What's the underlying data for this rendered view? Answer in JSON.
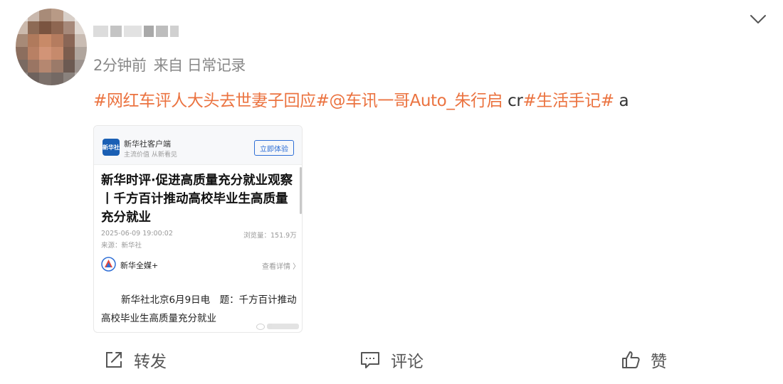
{
  "post": {
    "username": "",
    "time": "2分钟前",
    "source": "来自 日常记录",
    "content": {
      "tag1": "#网红车评人大头去世妻子回应#",
      "mention": "@车讯一哥Auto_朱行启",
      "plain1": " cr",
      "tag2": "#生活手记#",
      "plain2": " a"
    }
  },
  "card": {
    "app_logo_text": "新华社",
    "app_name": "新华社客户端",
    "app_slogan": "主流价值 从新看见",
    "try_button": "立即体验",
    "title": "新华时评·促进高质量充分就业观察丨千方百计推动高校毕业生高质量充分就业",
    "date": "2025-06-09 19:00:02",
    "views": "浏览量：151.9万",
    "source": "来源：新华社",
    "media_name": "新华全媒+",
    "detail_link": "查看详情 〉",
    "paragraph": "新华社北京6月9日电　题：千方百计推动高校毕业生高质量充分就业"
  },
  "actions": {
    "repost": "转发",
    "comment": "评论",
    "like": "赞"
  },
  "icons": [
    "chevron-down-icon",
    "repost-icon",
    "comment-icon",
    "like-icon",
    "media-logo-icon"
  ],
  "colors": {
    "topic": "#eb7340",
    "button_blue": "#2f6fd6",
    "meta_gray": "#888888"
  }
}
